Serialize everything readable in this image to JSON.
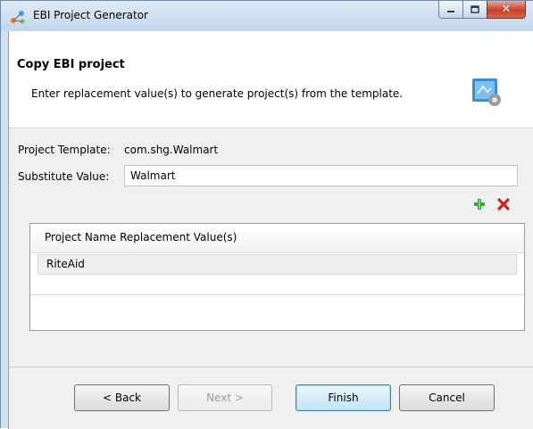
{
  "window": {
    "title": "EBI Project Generator",
    "colors": {
      "close_button": "#c4432b",
      "title_bar": "#c3d6ec",
      "add_icon": "#3aa63a",
      "remove_icon": "#d62020"
    }
  },
  "header": {
    "title": "Copy EBI project",
    "description": "Enter replacement value(s) to generate project(s) from the template."
  },
  "form": {
    "template_label": "Project Template:",
    "template_value": "com.shg.Walmart",
    "substitute_label": "Substitute Value:",
    "substitute_value": "Walmart"
  },
  "table": {
    "column_header": "Project Name Replacement Value(s)",
    "rows": [
      "RiteAid"
    ]
  },
  "buttons": {
    "back": "< Back",
    "next": "Next >",
    "finish": "Finish",
    "cancel": "Cancel"
  },
  "icons": {
    "app": "ebi-project-icon",
    "banner": "wizard-banner-icon",
    "add": "add-plus-icon",
    "remove": "remove-x-icon",
    "minimize": "minimize-icon",
    "maximize": "maximize-icon",
    "close": "close-icon"
  }
}
